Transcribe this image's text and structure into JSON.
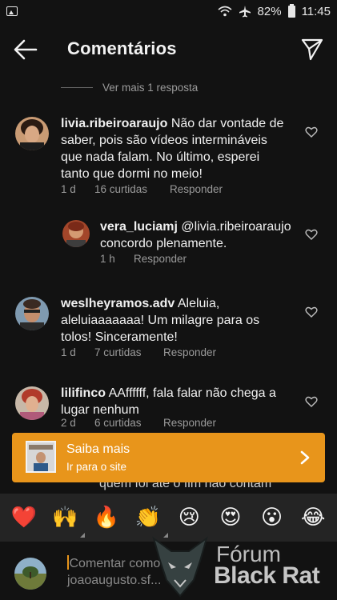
{
  "status_bar": {
    "battery": "82%",
    "time": "11:45"
  },
  "header": {
    "title": "Comentários"
  },
  "more_replies": "Ver mais 1 resposta",
  "comments": [
    {
      "username": "livia.ribeiroaraujo",
      "text_line1": " Não dar vontade de",
      "text_line2": "saber, pois são vídeos intermináveis",
      "text_line3": "que nada falam. No último, esperei",
      "text_line4": "tanto que dormi no meio!",
      "time": "1 d",
      "likes": "16 curtidas",
      "reply": "Responder"
    },
    {
      "username": "vera_luciamj",
      "text_line1": " @livia.ribeiroaraujo",
      "text_line2": "concordo plenamente.",
      "time": "1 h",
      "reply": "Responder"
    },
    {
      "username": "weslheyramos.adv",
      "text_line1": " Aleluia,",
      "text_line2": "aleluiaaaaaaa! Um milagre para os",
      "text_line3": "tolos! Sinceramente!",
      "time": "1 d",
      "likes": "7 curtidas",
      "reply": "Responder"
    },
    {
      "username": "lilifinco",
      "text_line1": " AAffffff, fala falar não chega a",
      "text_line2": "lugar nenhum",
      "time": "2 d",
      "likes": "6 curtidas",
      "reply": "Responder"
    }
  ],
  "peek_text": "quem foi até o fim não contam",
  "banner": {
    "title": "Saiba mais",
    "subtitle": "Ir para o site",
    "color": "#e8951b"
  },
  "emoji_bar": [
    "❤️",
    "🙌",
    "🔥",
    "👏",
    "😢",
    "😍",
    "😮",
    "😂"
  ],
  "input": {
    "placeholder_line1": "Comentar como",
    "placeholder_line2": "joaoaugusto.sf..."
  },
  "watermark": {
    "line1": "Fórum",
    "line2": "Black Rat"
  }
}
